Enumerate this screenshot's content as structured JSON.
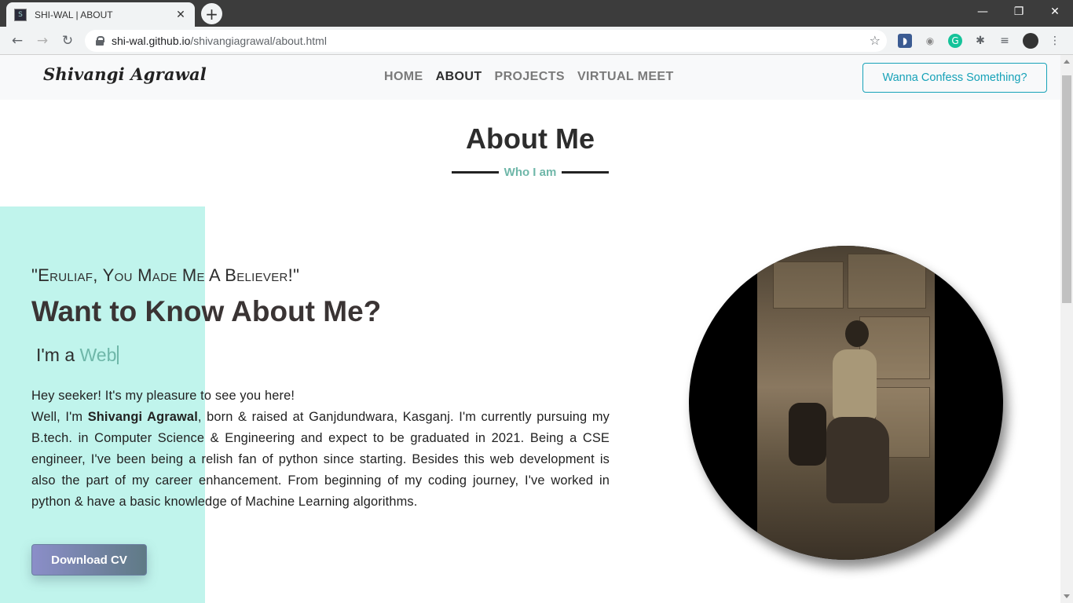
{
  "browser": {
    "tab_title": "SHI-WAL | ABOUT",
    "tab_close": "✕",
    "new_tab": "+",
    "url_host": "shi-wal.github.io",
    "url_path": "/shivangiagrawal/about.html",
    "window_controls": {
      "minimize": "—",
      "restore": "❐",
      "close": "✕"
    }
  },
  "navbar": {
    "brand": "Shivangi Agrawal",
    "items": [
      {
        "label": "HOME",
        "active": false
      },
      {
        "label": "ABOUT",
        "active": true
      },
      {
        "label": "PROJECTS",
        "active": false
      },
      {
        "label": "VIRTUAL MEET",
        "active": false
      }
    ],
    "confess_button": "Wanna Confess Something?"
  },
  "about": {
    "title": "About Me",
    "subtitle": "Who I am",
    "quote": "\"Eruliaf, You Made Me A Believer!\"",
    "heading": "Want to Know About Me?",
    "role_prefix": "I'm a",
    "role_word": "Web",
    "bio_line1": "Hey seeker! It's my pleasure to see you here!",
    "bio_intro": "Well, I'm",
    "bio_name": "Shivangi Agrawal",
    "bio_rest": ", born & raised at Ganjdundwara, Kasganj. I'm currently pursuing my B.tech. in Computer Science & Engineering and expect to be graduated in 2021. Being a CSE engineer, I've been being a relish fan of python since starting. Besides this web development is also the part of my career enhancement. From beginning of my coding journey, I've worked in python & have a basic knowledge of Machine Learning algorithms.",
    "cv_button": "Download CV"
  },
  "colors": {
    "accent_teal": "#6fb7a9",
    "confess_border": "#17a2b8",
    "mint_block": "#c0f4ec"
  }
}
